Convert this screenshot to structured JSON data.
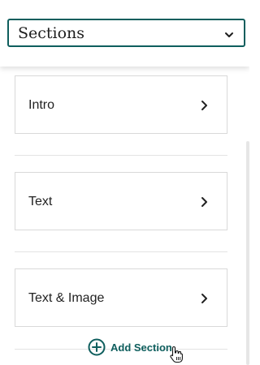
{
  "header": {
    "select_label": "Sections"
  },
  "sections": {
    "items": [
      {
        "label": "Intro"
      },
      {
        "label": "Text"
      },
      {
        "label": "Text & Image"
      }
    ],
    "add_label": "Add Section"
  },
  "colors": {
    "accent": "#0e5e5d",
    "border": "#d9d9d9",
    "text": "#222222"
  },
  "icons": {
    "select": "chevron-down-icon",
    "item": "chevron-right-icon",
    "add": "plus-circle-icon",
    "pointer": "hand-pointer-icon"
  }
}
